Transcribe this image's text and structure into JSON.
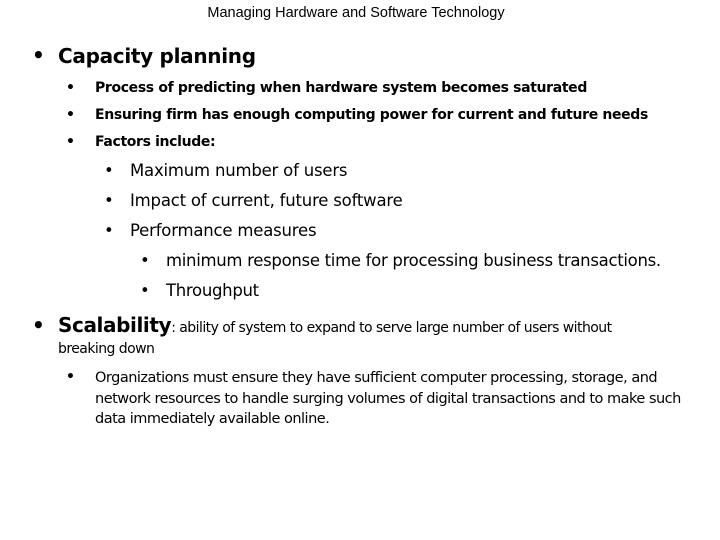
{
  "header": {
    "title": "Managing Hardware and Software Technology"
  },
  "bullet_glyph": "•",
  "capacity": {
    "heading": "Capacity planning",
    "points": [
      "Process of predicting when hardware system becomes saturated",
      "Ensuring firm has enough computing power for current and future needs",
      "Factors include:"
    ],
    "factors": [
      "Maximum number of users",
      "Impact of current, future software",
      "Performance measures"
    ],
    "performance_measures": [
      "minimum response time for processing business transactions.",
      "Throughput"
    ]
  },
  "scalability": {
    "term": "Scalability",
    "definition_line1": ": ability of system to expand to serve large number of users without",
    "definition_line2": "breaking down",
    "points": [
      "Organizations must ensure they have sufficient computer processing, storage, and network resources to handle surging volumes of digital transactions and to make such data immediately available online."
    ]
  }
}
